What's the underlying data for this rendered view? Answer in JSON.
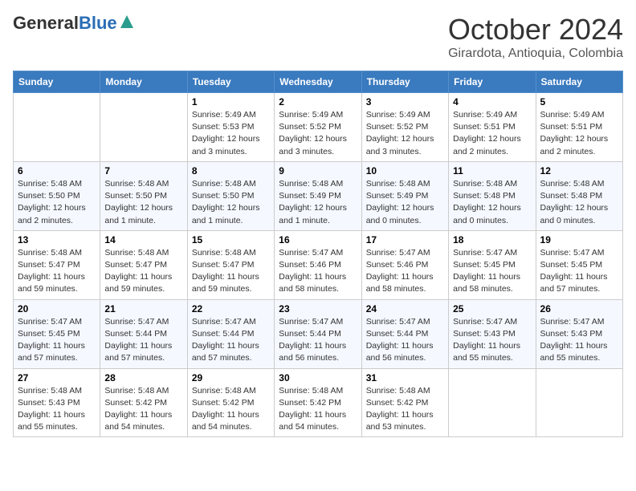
{
  "header": {
    "logo_general": "General",
    "logo_blue": "Blue",
    "month_title": "October 2024",
    "subtitle": "Girardota, Antioquia, Colombia"
  },
  "weekdays": [
    "Sunday",
    "Monday",
    "Tuesday",
    "Wednesday",
    "Thursday",
    "Friday",
    "Saturday"
  ],
  "weeks": [
    [
      {
        "day": "",
        "info": ""
      },
      {
        "day": "",
        "info": ""
      },
      {
        "day": "1",
        "info": "Sunrise: 5:49 AM\nSunset: 5:53 PM\nDaylight: 12 hours and 3 minutes."
      },
      {
        "day": "2",
        "info": "Sunrise: 5:49 AM\nSunset: 5:52 PM\nDaylight: 12 hours and 3 minutes."
      },
      {
        "day": "3",
        "info": "Sunrise: 5:49 AM\nSunset: 5:52 PM\nDaylight: 12 hours and 3 minutes."
      },
      {
        "day": "4",
        "info": "Sunrise: 5:49 AM\nSunset: 5:51 PM\nDaylight: 12 hours and 2 minutes."
      },
      {
        "day": "5",
        "info": "Sunrise: 5:49 AM\nSunset: 5:51 PM\nDaylight: 12 hours and 2 minutes."
      }
    ],
    [
      {
        "day": "6",
        "info": "Sunrise: 5:48 AM\nSunset: 5:50 PM\nDaylight: 12 hours and 2 minutes."
      },
      {
        "day": "7",
        "info": "Sunrise: 5:48 AM\nSunset: 5:50 PM\nDaylight: 12 hours and 1 minute."
      },
      {
        "day": "8",
        "info": "Sunrise: 5:48 AM\nSunset: 5:50 PM\nDaylight: 12 hours and 1 minute."
      },
      {
        "day": "9",
        "info": "Sunrise: 5:48 AM\nSunset: 5:49 PM\nDaylight: 12 hours and 1 minute."
      },
      {
        "day": "10",
        "info": "Sunrise: 5:48 AM\nSunset: 5:49 PM\nDaylight: 12 hours and 0 minutes."
      },
      {
        "day": "11",
        "info": "Sunrise: 5:48 AM\nSunset: 5:48 PM\nDaylight: 12 hours and 0 minutes."
      },
      {
        "day": "12",
        "info": "Sunrise: 5:48 AM\nSunset: 5:48 PM\nDaylight: 12 hours and 0 minutes."
      }
    ],
    [
      {
        "day": "13",
        "info": "Sunrise: 5:48 AM\nSunset: 5:47 PM\nDaylight: 11 hours and 59 minutes."
      },
      {
        "day": "14",
        "info": "Sunrise: 5:48 AM\nSunset: 5:47 PM\nDaylight: 11 hours and 59 minutes."
      },
      {
        "day": "15",
        "info": "Sunrise: 5:48 AM\nSunset: 5:47 PM\nDaylight: 11 hours and 59 minutes."
      },
      {
        "day": "16",
        "info": "Sunrise: 5:47 AM\nSunset: 5:46 PM\nDaylight: 11 hours and 58 minutes."
      },
      {
        "day": "17",
        "info": "Sunrise: 5:47 AM\nSunset: 5:46 PM\nDaylight: 11 hours and 58 minutes."
      },
      {
        "day": "18",
        "info": "Sunrise: 5:47 AM\nSunset: 5:45 PM\nDaylight: 11 hours and 58 minutes."
      },
      {
        "day": "19",
        "info": "Sunrise: 5:47 AM\nSunset: 5:45 PM\nDaylight: 11 hours and 57 minutes."
      }
    ],
    [
      {
        "day": "20",
        "info": "Sunrise: 5:47 AM\nSunset: 5:45 PM\nDaylight: 11 hours and 57 minutes."
      },
      {
        "day": "21",
        "info": "Sunrise: 5:47 AM\nSunset: 5:44 PM\nDaylight: 11 hours and 57 minutes."
      },
      {
        "day": "22",
        "info": "Sunrise: 5:47 AM\nSunset: 5:44 PM\nDaylight: 11 hours and 57 minutes."
      },
      {
        "day": "23",
        "info": "Sunrise: 5:47 AM\nSunset: 5:44 PM\nDaylight: 11 hours and 56 minutes."
      },
      {
        "day": "24",
        "info": "Sunrise: 5:47 AM\nSunset: 5:44 PM\nDaylight: 11 hours and 56 minutes."
      },
      {
        "day": "25",
        "info": "Sunrise: 5:47 AM\nSunset: 5:43 PM\nDaylight: 11 hours and 55 minutes."
      },
      {
        "day": "26",
        "info": "Sunrise: 5:47 AM\nSunset: 5:43 PM\nDaylight: 11 hours and 55 minutes."
      }
    ],
    [
      {
        "day": "27",
        "info": "Sunrise: 5:48 AM\nSunset: 5:43 PM\nDaylight: 11 hours and 55 minutes."
      },
      {
        "day": "28",
        "info": "Sunrise: 5:48 AM\nSunset: 5:42 PM\nDaylight: 11 hours and 54 minutes."
      },
      {
        "day": "29",
        "info": "Sunrise: 5:48 AM\nSunset: 5:42 PM\nDaylight: 11 hours and 54 minutes."
      },
      {
        "day": "30",
        "info": "Sunrise: 5:48 AM\nSunset: 5:42 PM\nDaylight: 11 hours and 54 minutes."
      },
      {
        "day": "31",
        "info": "Sunrise: 5:48 AM\nSunset: 5:42 PM\nDaylight: 11 hours and 53 minutes."
      },
      {
        "day": "",
        "info": ""
      },
      {
        "day": "",
        "info": ""
      }
    ]
  ]
}
